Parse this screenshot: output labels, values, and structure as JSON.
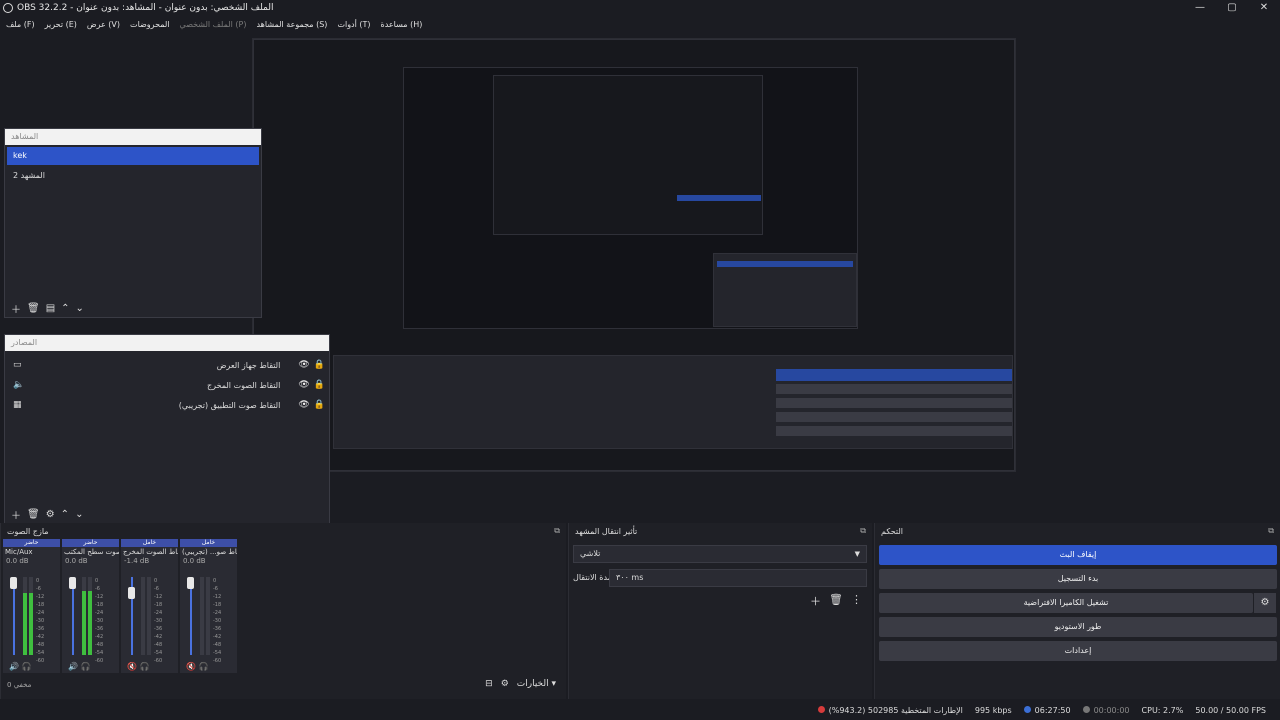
{
  "window": {
    "title": "OBS 32.2.2 - الملف الشخصي: بدون عنوان - المشاهد: بدون عنوان",
    "controls": {
      "minimize": "—",
      "maximize": "▢",
      "close": "✕"
    }
  },
  "menu": [
    {
      "label": "ملف (F)",
      "disabled": false
    },
    {
      "label": "تحرير (E)",
      "disabled": false
    },
    {
      "label": "عرض (V)",
      "disabled": false
    },
    {
      "label": "المحروضات",
      "disabled": false
    },
    {
      "label": "الملف الشخصي (P)",
      "disabled": true
    },
    {
      "label": "مجموعة المشاهد (S)",
      "disabled": false
    },
    {
      "label": "أدوات (T)",
      "disabled": false
    },
    {
      "label": "مساعدة (H)",
      "disabled": false
    }
  ],
  "scenes": {
    "header": "المشاهد",
    "items": [
      "kek",
      "المشهد 2"
    ],
    "active_index": 0
  },
  "sources": {
    "header": "المصادر",
    "items": [
      {
        "label": "التقاط جهاز العرض",
        "icon": "monitor-icon"
      },
      {
        "label": "التقاط الصوت المخرج",
        "icon": "speaker-icon"
      },
      {
        "label": "التقاط صوت التطبيق (تجريبي)",
        "icon": "app-audio-icon"
      }
    ]
  },
  "mixer": {
    "header": "مازج الصوت",
    "footer": "مخفي 0",
    "channels": [
      {
        "tag": "حاضر",
        "name": "Mic/Aux",
        "db": "0.0 dB",
        "level": 0.8,
        "volume": 1.0,
        "muted": false
      },
      {
        "tag": "حاضر",
        "name": "صوت سطح المكتب",
        "db": "0.0 dB",
        "level": 0.82,
        "volume": 1.0,
        "muted": false
      },
      {
        "tag": "خامل",
        "name": "التقاط الصوت المخرج",
        "db": "-1.4 dB",
        "level": 0.0,
        "volume": 0.85,
        "muted": true
      },
      {
        "tag": "خامل",
        "name": "التقاط صو... (تجريبي)",
        "db": "0.0 dB",
        "level": 0.0,
        "volume": 1.0,
        "muted": true
      }
    ],
    "scale": [
      "0",
      "-6",
      "-12",
      "-18",
      "-24",
      "-30",
      "-36",
      "-42",
      "-48",
      "-54",
      "-60"
    ],
    "options_label": "الخيارات"
  },
  "transitions": {
    "header": "تأثير انتقال المشهد",
    "selected": "تلاشي",
    "duration_label": "مدة الانتقال",
    "duration_value": "٣٠٠ ms"
  },
  "controls": {
    "header": "التحكم",
    "buttons": [
      "إيقاف البث",
      "بدء التسجيل",
      "تشغيل الكاميرا الافتراضية",
      "طور الاستوديو",
      "إعدادات"
    ]
  },
  "status": {
    "dropped": "الإطارات المتخطية 502985 (943.2%)",
    "bitrate": "995 kbps",
    "stream_time": "06:27:50",
    "rec_time": "00:00:00",
    "cpu": "CPU: 2.7%",
    "fps": "50.00 / 50.00 FPS",
    "colors": {
      "live": "#3b6fd6",
      "drop": "#d63b3b",
      "rec": "#777777"
    }
  }
}
